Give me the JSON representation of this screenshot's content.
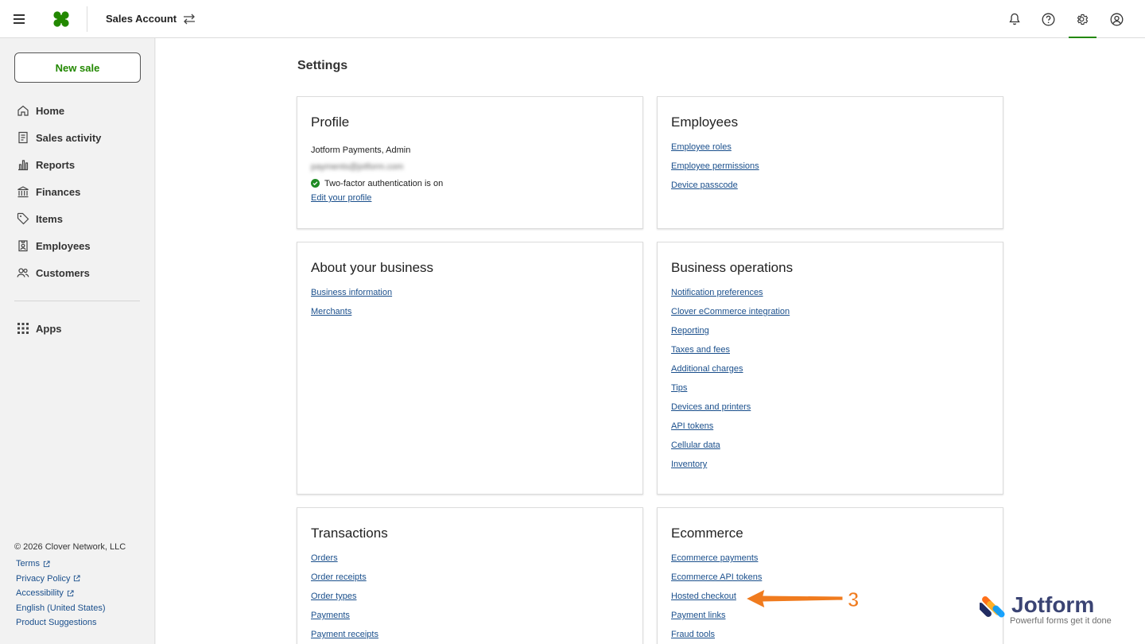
{
  "header": {
    "account_name": "Sales Account",
    "icons": [
      "menu-icon",
      "clover-logo",
      "swap-icon",
      "bell-icon",
      "help-icon",
      "gear-icon",
      "account-icon"
    ]
  },
  "sidebar": {
    "new_sale_label": "New sale",
    "items": [
      {
        "label": "Home",
        "icon": "home-icon"
      },
      {
        "label": "Sales activity",
        "icon": "receipt-icon"
      },
      {
        "label": "Reports",
        "icon": "bar-chart-icon"
      },
      {
        "label": "Finances",
        "icon": "bank-icon"
      },
      {
        "label": "Items",
        "icon": "tag-icon"
      },
      {
        "label": "Employees",
        "icon": "badge-icon"
      },
      {
        "label": "Customers",
        "icon": "people-icon"
      }
    ],
    "apps_label": "Apps",
    "footer": {
      "copyright": "© 2026 Clover Network, LLC",
      "links": [
        "Terms",
        "Privacy Policy",
        "Accessibility",
        "English (United States)",
        "Product Suggestions"
      ]
    }
  },
  "main": {
    "title": "Settings",
    "profile": {
      "title": "Profile",
      "name": "Jotform Payments, Admin",
      "email": "payments@jotform.com",
      "two_factor": "Two-factor authentication is on",
      "edit_link": "Edit your profile"
    },
    "employees": {
      "title": "Employees",
      "links": [
        "Employee roles",
        "Employee permissions",
        "Device passcode"
      ]
    },
    "about": {
      "title": "About your business",
      "links": [
        "Business information",
        "Merchants"
      ]
    },
    "operations": {
      "title": "Business operations",
      "links": [
        "Notification preferences",
        "Clover eCommerce integration",
        "Reporting",
        "Taxes and fees",
        "Additional charges",
        "Tips",
        "Devices and printers",
        "API tokens",
        "Cellular data",
        "Inventory"
      ]
    },
    "transactions": {
      "title": "Transactions",
      "links": [
        "Orders",
        "Order receipts",
        "Order types",
        "Payments",
        "Payment receipts"
      ]
    },
    "ecommerce": {
      "title": "Ecommerce",
      "links": [
        "Ecommerce payments",
        "Ecommerce API tokens",
        "Hosted checkout",
        "Payment links",
        "Fraud tools"
      ]
    }
  },
  "annotation": {
    "step_number": "3",
    "arrow_color": "#f07b1e"
  },
  "watermark": {
    "brand": "Jotform",
    "tagline": "Powerful forms get it done"
  },
  "colors": {
    "accent_green": "#228800",
    "link_blue": "#1a4f8c"
  }
}
